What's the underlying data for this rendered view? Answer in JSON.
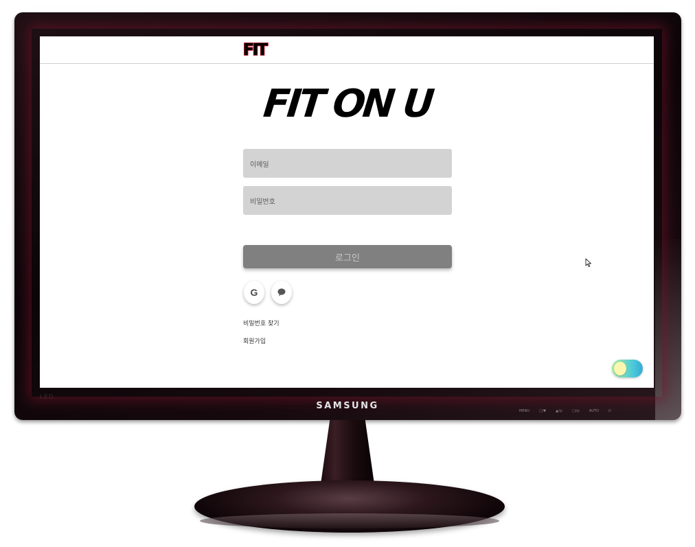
{
  "monitor": {
    "brand": "SAMSUNG",
    "led_label": "LED",
    "controls": [
      "MENU",
      "□/▼",
      "▲/◎",
      "□/◎",
      "AUTO",
      "⏻"
    ]
  },
  "app": {
    "logo_text": "FIT",
    "hero_title": "FIT ON U"
  },
  "login_form": {
    "email_placeholder": "이메일",
    "password_placeholder": "비밀번호",
    "login_button_label": "로그인"
  },
  "social_login": {
    "google_icon": "google-g-icon",
    "google_label": "G",
    "kakao_icon": "chat-bubble-icon"
  },
  "links": {
    "find_password": "비밀번호 찾기",
    "signup": "회원가입"
  },
  "theme_toggle": {
    "icon": "theme-toggle-switch",
    "accent_colors": [
      "#a8f0a0",
      "#49c8d9"
    ]
  }
}
